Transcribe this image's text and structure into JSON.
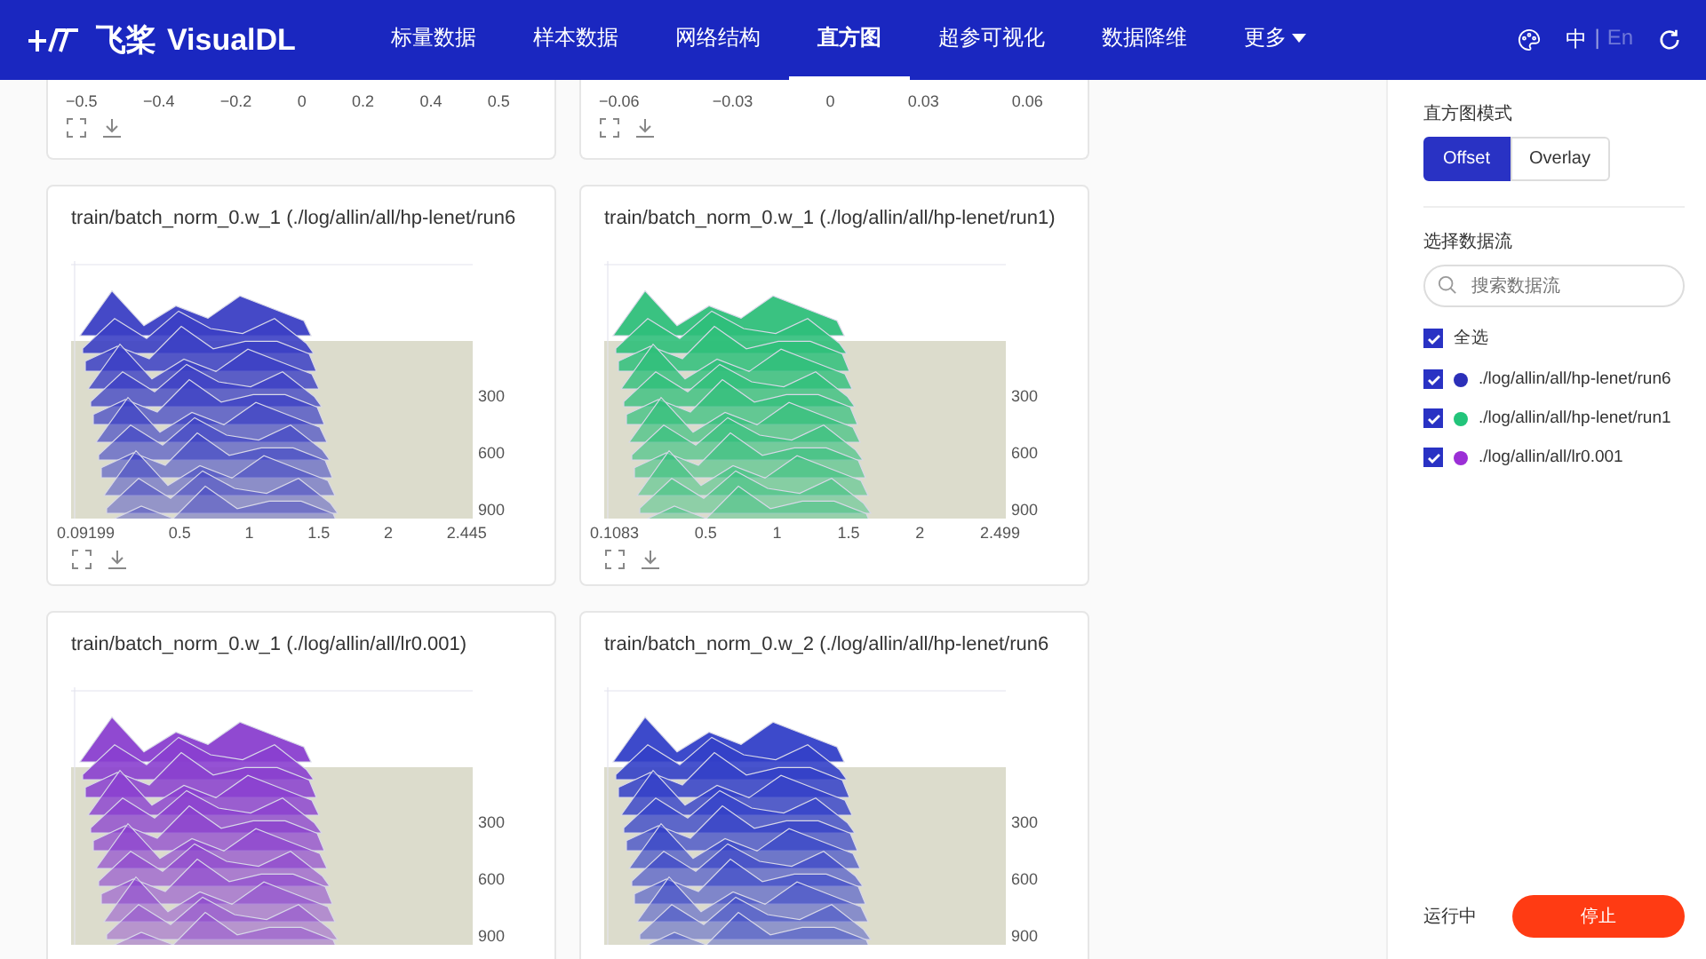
{
  "header": {
    "brand": "飞桨",
    "product": "VisualDL",
    "nav": [
      {
        "label": "标量数据",
        "selected": false,
        "dropdown": false
      },
      {
        "label": "样本数据",
        "selected": false,
        "dropdown": false
      },
      {
        "label": "网络结构",
        "selected": false,
        "dropdown": false
      },
      {
        "label": "直方图",
        "selected": true,
        "dropdown": false
      },
      {
        "label": "超参可视化",
        "selected": false,
        "dropdown": false
      },
      {
        "label": "数据降维",
        "selected": false,
        "dropdown": false
      },
      {
        "label": "更多",
        "selected": false,
        "dropdown": true
      }
    ],
    "languages": [
      {
        "label": "中",
        "selected": true
      },
      {
        "label": "En",
        "selected": false
      }
    ],
    "language_separator": "|"
  },
  "cards": [
    {
      "kind": "tail",
      "x_ticks": [
        "−0.5",
        "−0.4",
        "−0.2",
        "0",
        "0.2",
        "0.4",
        "0.5"
      ]
    },
    {
      "kind": "tail",
      "x_ticks": [
        "−0.06",
        "−0.03",
        "0",
        "0.03",
        "0.06"
      ]
    },
    {
      "kind": "full",
      "title": "train/batch_norm_0.w_1 (./log/allin/all/hp-lenet/run6",
      "color": "#3b3fc4",
      "x_ticks": [
        "0.09199",
        "0.5",
        "1",
        "1.5",
        "2",
        "2.445"
      ],
      "y_ticks": [
        "300",
        "600",
        "900"
      ]
    },
    {
      "kind": "full",
      "title": "train/batch_norm_0.w_1 (./log/allin/all/hp-lenet/run1)",
      "color": "#2fbf7a",
      "x_ticks": [
        "0.1083",
        "0.5",
        "1",
        "1.5",
        "2",
        "2.499"
      ],
      "y_ticks": [
        "300",
        "600",
        "900"
      ]
    },
    {
      "kind": "full",
      "title": "train/batch_norm_0.w_1 (./log/allin/all/lr0.001)",
      "color": "#8a3fcf",
      "y_ticks": [
        "300",
        "600",
        "900"
      ]
    },
    {
      "kind": "full",
      "title": "train/batch_norm_0.w_2 (./log/allin/all/hp-lenet/run6",
      "color": "#3340c8",
      "y_ticks": [
        "300",
        "600",
        "900"
      ]
    }
  ],
  "sidebar": {
    "mode_label": "直方图模式",
    "modes": [
      {
        "label": "Offset",
        "selected": true
      },
      {
        "label": "Overlay",
        "selected": false
      }
    ],
    "streams_label": "选择数据流",
    "search": {
      "placeholder": "搜索数据流"
    },
    "select_all": {
      "label": "全选",
      "checked": true
    },
    "runs": [
      {
        "label": "./log/allin/all/hp-lenet/run6",
        "checked": true,
        "color": "#2b2fb8"
      },
      {
        "label": "./log/allin/all/hp-lenet/run1",
        "checked": true,
        "color": "#22c47a"
      },
      {
        "label": "./log/allin/all/lr0.001",
        "checked": true,
        "color": "#9b2fd6"
      }
    ],
    "status": "运行中",
    "stop_button": "停止"
  }
}
